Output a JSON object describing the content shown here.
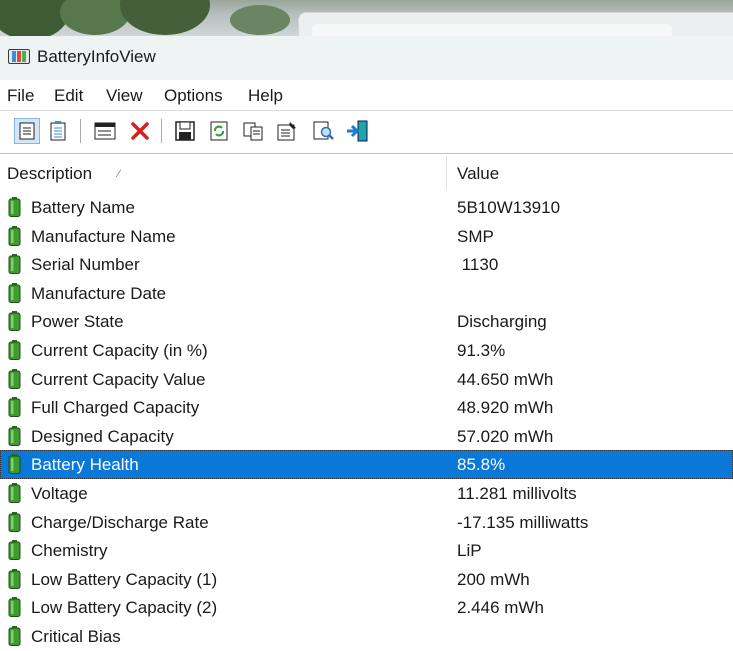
{
  "window": {
    "title": "BatteryInfoView"
  },
  "menu": {
    "items": [
      {
        "label": "File",
        "name": "menu-file"
      },
      {
        "label": "Edit",
        "name": "menu-edit"
      },
      {
        "label": "View",
        "name": "menu-view"
      },
      {
        "label": "Options",
        "name": "menu-options"
      },
      {
        "label": "Help",
        "name": "menu-help"
      }
    ]
  },
  "toolbar": {
    "buttons": [
      {
        "icon": "battery-info-mode-icon",
        "active": true
      },
      {
        "icon": "battery-log-mode-icon",
        "active": false
      },
      {
        "icon": "window-icon",
        "active": false
      },
      {
        "icon": "delete-icon",
        "active": false
      },
      {
        "icon": "save-icon",
        "active": false
      },
      {
        "icon": "refresh-icon",
        "active": false
      },
      {
        "icon": "copy-icon",
        "active": false
      },
      {
        "icon": "properties-icon",
        "active": false
      },
      {
        "icon": "find-icon",
        "active": false
      },
      {
        "icon": "exit-icon",
        "active": false
      }
    ]
  },
  "table": {
    "columns": [
      "Description",
      "Value"
    ],
    "rows": [
      {
        "desc": "Battery Name",
        "value": "5B10W13910",
        "selected": false
      },
      {
        "desc": "Manufacture Name",
        "value": "SMP",
        "selected": false
      },
      {
        "desc": "Serial Number",
        "value": " 1130",
        "selected": false
      },
      {
        "desc": "Manufacture Date",
        "value": "",
        "selected": false
      },
      {
        "desc": "Power State",
        "value": "Discharging",
        "selected": false
      },
      {
        "desc": "Current Capacity (in %)",
        "value": "91.3%",
        "selected": false
      },
      {
        "desc": "Current Capacity Value",
        "value": "44.650 mWh",
        "selected": false
      },
      {
        "desc": "Full Charged Capacity",
        "value": "48.920 mWh",
        "selected": false
      },
      {
        "desc": "Designed Capacity",
        "value": "57.020 mWh",
        "selected": false
      },
      {
        "desc": "Battery Health",
        "value": "85.8%",
        "selected": true
      },
      {
        "desc": "Voltage",
        "value": "11.281 millivolts",
        "selected": false
      },
      {
        "desc": "Charge/Discharge Rate",
        "value": "-17.135 milliwatts",
        "selected": false
      },
      {
        "desc": "Chemistry",
        "value": "LiP",
        "selected": false
      },
      {
        "desc": "Low Battery Capacity (1)",
        "value": "200 mWh",
        "selected": false
      },
      {
        "desc": "Low Battery Capacity (2)",
        "value": "2.446 mWh",
        "selected": false
      },
      {
        "desc": "Critical Bias",
        "value": "",
        "selected": false
      }
    ]
  },
  "colors": {
    "selection": "#0a78d7",
    "battery_green": "#3f9a2f"
  }
}
